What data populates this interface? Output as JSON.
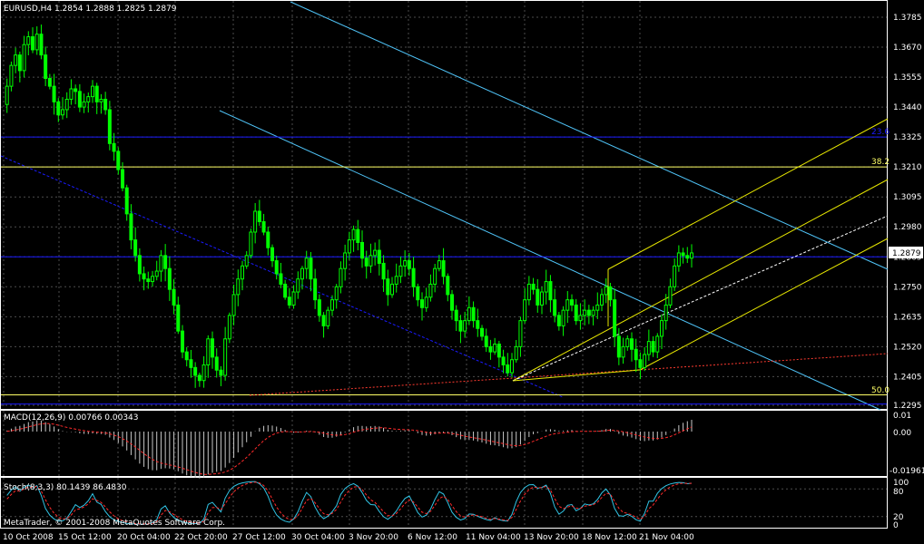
{
  "header": {
    "symbol_line": "EURUSD,H4  1.2854 1.2888 1.2825 1.2879"
  },
  "main_panel": {
    "price_labels": [
      "1.3785",
      "1.3670",
      "1.3555",
      "1.3440",
      "1.3325",
      "1.3210",
      "1.3095",
      "1.2980",
      "1.2865",
      "1.2750",
      "1.2635",
      "1.2520",
      "1.2405",
      "1.2295"
    ],
    "current_price_label": "1.2879",
    "fib_labels": {
      "top": "23.6",
      "mid": "38.2",
      "bottom": "50.0"
    }
  },
  "macd_panel": {
    "label": "MACD(12,26,9) 0.00766 0.00343",
    "scale_labels": [
      "0.01",
      "0.00",
      "-0.01961"
    ]
  },
  "stoch_panel": {
    "label": "Stoch(8,3,3) 80.1439 86.4830",
    "scale_labels": [
      "100",
      "80",
      "20",
      "0"
    ],
    "copyright": "MetaTrader, © 2001-2008 MetaQuotes Software Corp."
  },
  "time_axis": {
    "labels": [
      "10 Oct 2008",
      "15 Oct 12:00",
      "20 Oct 04:00",
      "22 Oct 20:00",
      "27 Oct 12:00",
      "30 Oct 04:00",
      "3 Nov 20:00",
      "6 Nov 12:00",
      "11 Nov 04:00",
      "13 Nov 20:00",
      "18 Nov 12:00",
      "21 Nov 04:00"
    ]
  },
  "colors": {
    "background": "#000000",
    "candle": "#00ff00",
    "grid": "#4d4d4d",
    "channel_cyan": "#4fc3f7",
    "fib_blue": "#1a1aff",
    "fib_yellow": "#ffff66",
    "fib_red": "#ff3b30",
    "pitchfork": "#e6e600",
    "macd_hist": "#c8c8c8",
    "signal": "#ff2a2a",
    "stoch_main": "#31c5e6",
    "stoch_signal": "#ff2a2a"
  },
  "chart_data": {
    "type": "candlestick",
    "symbol": "EURUSD",
    "timeframe": "H4",
    "ohlc_last": {
      "open": 1.2854,
      "high": 1.2888,
      "low": 1.2825,
      "close": 1.2879
    },
    "x_ticks": [
      "10 Oct 2008",
      "15 Oct 12:00",
      "20 Oct 04:00",
      "22 Oct 20:00",
      "27 Oct 12:00",
      "30 Oct 04:00",
      "3 Nov 20:00",
      "6 Nov 12:00",
      "11 Nov 04:00",
      "13 Nov 20:00",
      "18 Nov 12:00",
      "21 Nov 04:00"
    ],
    "y_ticks": [
      1.3785,
      1.367,
      1.3555,
      1.344,
      1.3325,
      1.321,
      1.3095,
      1.298,
      1.2865,
      1.275,
      1.2635,
      1.252,
      1.2405,
      1.2295
    ],
    "ylim": [
      1.228,
      1.385
    ],
    "grid": true,
    "close_path": [
      1.345,
      1.352,
      1.36,
      1.364,
      1.358,
      1.368,
      1.371,
      1.366,
      1.372,
      1.364,
      1.355,
      1.352,
      1.346,
      1.341,
      1.343,
      1.347,
      1.351,
      1.35,
      1.344,
      1.346,
      1.348,
      1.352,
      1.346,
      1.347,
      1.343,
      1.33,
      1.327,
      1.32,
      1.313,
      1.303,
      1.293,
      1.287,
      1.28,
      1.278,
      1.277,
      1.279,
      1.281,
      1.287,
      1.282,
      1.274,
      1.268,
      1.258,
      1.25,
      1.247,
      1.244,
      1.241,
      1.239,
      1.245,
      1.255,
      1.248,
      1.243,
      1.241,
      1.255,
      1.264,
      1.272,
      1.278,
      1.283,
      1.287,
      1.296,
      1.304,
      1.3,
      1.296,
      1.29,
      1.285,
      1.28,
      1.276,
      1.271,
      1.268,
      1.273,
      1.278,
      1.282,
      1.286,
      1.278,
      1.27,
      1.264,
      1.26,
      1.266,
      1.27,
      1.275,
      1.282,
      1.288,
      1.293,
      1.297,
      1.292,
      1.286,
      1.283,
      1.287,
      1.289,
      1.284,
      1.278,
      1.272,
      1.276,
      1.279,
      1.283,
      1.285,
      1.282,
      1.275,
      1.27,
      1.267,
      1.271,
      1.276,
      1.282,
      1.285,
      1.279,
      1.272,
      1.266,
      1.262,
      1.258,
      1.262,
      1.267,
      1.262,
      1.259,
      1.256,
      1.252,
      1.25,
      1.253,
      1.248,
      1.245,
      1.242,
      1.247,
      1.252,
      1.262,
      1.27,
      1.276,
      1.274,
      1.268,
      1.273,
      1.277,
      1.27,
      1.264,
      1.26,
      1.266,
      1.27,
      1.268,
      1.262,
      1.264,
      1.266,
      1.264,
      1.266,
      1.268,
      1.272,
      1.275,
      1.27,
      1.256,
      1.248,
      1.252,
      1.255,
      1.251,
      1.247,
      1.244,
      1.249,
      1.254,
      1.25,
      1.256,
      1.262,
      1.268,
      1.275,
      1.283,
      1.288,
      1.287,
      1.286,
      1.288
    ],
    "macd": {
      "main": 0.00766,
      "signal": 0.00343,
      "ylim": [
        -0.01961,
        0.01
      ]
    },
    "stochastic": {
      "main": 80.1439,
      "signal": 86.483,
      "ylim": [
        0,
        100
      ],
      "levels": [
        80,
        20
      ]
    },
    "fibonacci_levels": [
      {
        "label": "23.6",
        "price": 1.3325
      },
      {
        "label": "38.2",
        "price": 1.321
      },
      {
        "label": "50.0",
        "price": 1.232
      }
    ],
    "current_price": 1.2879
  }
}
